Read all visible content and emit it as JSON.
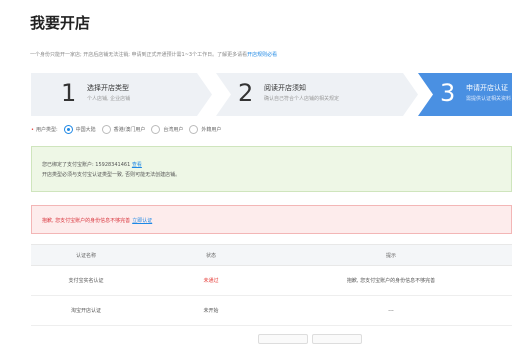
{
  "page": {
    "title": "我要开店",
    "intro": "一个身份只能开一家店; 开店后店铺无法注销; 申请到正式开通预计需1~3个工作日。了解更多请看",
    "intro_link": "开店规则必看"
  },
  "steps": [
    {
      "num": "1",
      "title": "选择开店类型",
      "desc": "个人店铺, 企业店铺"
    },
    {
      "num": "2",
      "title": "阅读开店须知",
      "desc": "确认自己符合个人店铺的相关规定"
    },
    {
      "num": "3",
      "title": "申请开店认证",
      "desc": "需提供认证相关资料"
    }
  ],
  "user_type": {
    "label": "用户类型:",
    "options": [
      "中国大陆",
      "香港/澳门用户",
      "台湾用户",
      "外籍用户"
    ],
    "selected": "中国大陆"
  },
  "notice": {
    "line1": "您已绑定了支付宝账户: 15928341461",
    "line1_link": "查看",
    "line2": "开店类型必须与支付宝认证类型一致, 否则可能无法创建店铺。"
  },
  "error": {
    "text": "抱歉, 您支付宝账户的身份信息不够完善",
    "link": "立即认证"
  },
  "table": {
    "headers": [
      "认证名称",
      "状态",
      "提示"
    ],
    "rows": [
      [
        "支付宝实名认证",
        "未通过",
        "抱歉, 您支付宝账户的身份信息不够完善"
      ],
      [
        "淘宝开店认证",
        "未开始",
        "---"
      ]
    ]
  },
  "colors": {
    "step_inactive": "#eef1f5",
    "step_active": "#4a90e2",
    "accent_blue": "#1e88e5",
    "error_red": "#e53935",
    "notice_green_bg": "#eef7e6",
    "error_bg": "#fdecec"
  }
}
